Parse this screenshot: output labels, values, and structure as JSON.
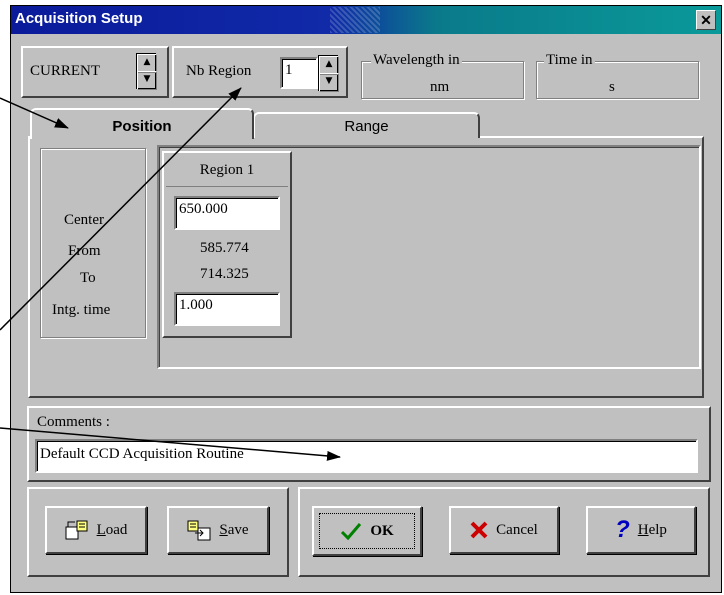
{
  "window": {
    "title": "Acquisition Setup",
    "close_label": "✕"
  },
  "top": {
    "mode_value": "CURRENT",
    "nb_region_label": "Nb Region",
    "nb_region_value": "1",
    "wavelength_legend": "Wavelength in",
    "wavelength_unit": "nm",
    "time_legend": "Time in",
    "time_unit": "s"
  },
  "tabs": [
    {
      "label": "Position",
      "active": true
    },
    {
      "label": "Range",
      "active": false
    }
  ],
  "row_labels": {
    "center": "Center",
    "from": "From",
    "to": "To",
    "intg_time": "Intg. time"
  },
  "region": {
    "header": "Region 1",
    "center": "650.000",
    "from": "585.774",
    "to": "714.325",
    "intg_time": "1.000"
  },
  "comments": {
    "label": "Comments :",
    "value": "Default CCD Acquisition Routine"
  },
  "buttons": {
    "load": "Load",
    "save": "Save",
    "ok": "OK",
    "cancel": "Cancel",
    "help": "Help"
  },
  "colors": {
    "title_bar": "#0a1a9a",
    "dialog_bg": "#c0c0c0",
    "cancel_icon": "#cc0000",
    "ok_icon": "#008000",
    "help_icon": "#0000c0"
  }
}
